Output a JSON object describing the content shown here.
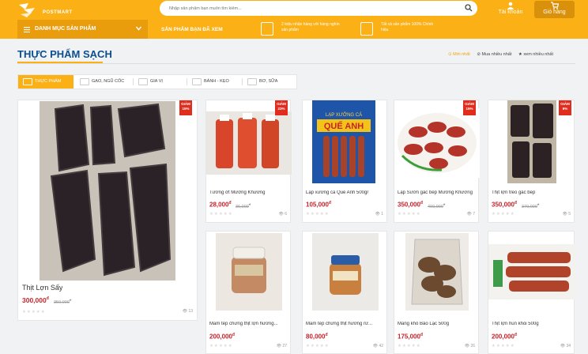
{
  "header": {
    "logo_text": "POSTMART",
    "search_placeholder": "Nhập sản phẩm bạn muốn tìm kiếm...",
    "account_label": "Tài khoản",
    "cart_label": "Giỏ hàng",
    "cart_count": "0"
  },
  "nav": {
    "category_menu": "DANH MỤC SẢN PHẨM",
    "viewed_label": "SẢN PHẨM BẠN ĐÃ XEM",
    "promo1": "2 triệu nhận hàng với hàng nghìn sản phẩm",
    "promo2": "Tất cả sản phẩm 100% Chính hiệu"
  },
  "section": {
    "title": "THỰC PHẨM SẠCH",
    "sorts": [
      "Mới nhất",
      "Mua nhiều nhất",
      "xem nhiều nhất"
    ],
    "tabs": [
      "THỰC PHẨM",
      "GẠO, NGŨ CỐC",
      "GIA VỊ",
      "BÁNH - KẸO",
      "BƠ, SỮA"
    ]
  },
  "products": [
    {
      "name": "Thịt Lợn Sấy",
      "price": "300,000",
      "old_price": "350,000",
      "discount": "15%",
      "views": "13"
    },
    {
      "name": "Tương ớt Mường Khương",
      "price": "28,000",
      "old_price": "36,000",
      "discount": "23%",
      "views": "6"
    },
    {
      "name": "Lạp xưởng cá Quế Anh 500gr",
      "price": "105,000",
      "old_price": "",
      "discount": "",
      "views": "1"
    },
    {
      "name": "Lạp Sườn gác bếp Mường Khương",
      "price": "350,000",
      "old_price": "400,000",
      "discount": "15%",
      "views": "7"
    },
    {
      "name": "Thịt lợn treo gác bếp",
      "price": "350,000",
      "old_price": "370,000",
      "discount": "6%",
      "views": "5"
    },
    {
      "name": "Mắm tép chưng thịt lợn hương...",
      "price": "200,000",
      "old_price": "",
      "discount": "",
      "views": "27"
    },
    {
      "name": "Mắm tép chưng thịt hương rừ...",
      "price": "80,000",
      "old_price": "",
      "discount": "",
      "views": "42"
    },
    {
      "name": "Măng khô Bảo Lạc 500g",
      "price": "175,000",
      "old_price": "",
      "discount": "",
      "views": "26"
    },
    {
      "name": "Thịt lợn hun khói 500g",
      "price": "200,000",
      "old_price": "",
      "discount": "",
      "views": "34"
    }
  ],
  "labels": {
    "discount_word": "GIẢM",
    "currency": "đ",
    "stars": "★★★★★",
    "label_brand": "QUẾ ANH",
    "label_top": "LẠP XƯỞNG CÁ"
  },
  "colors": {
    "brand": "#fbb016",
    "price": "#c8232c",
    "title": "#0b4f91",
    "badge": "#e02d1e"
  }
}
